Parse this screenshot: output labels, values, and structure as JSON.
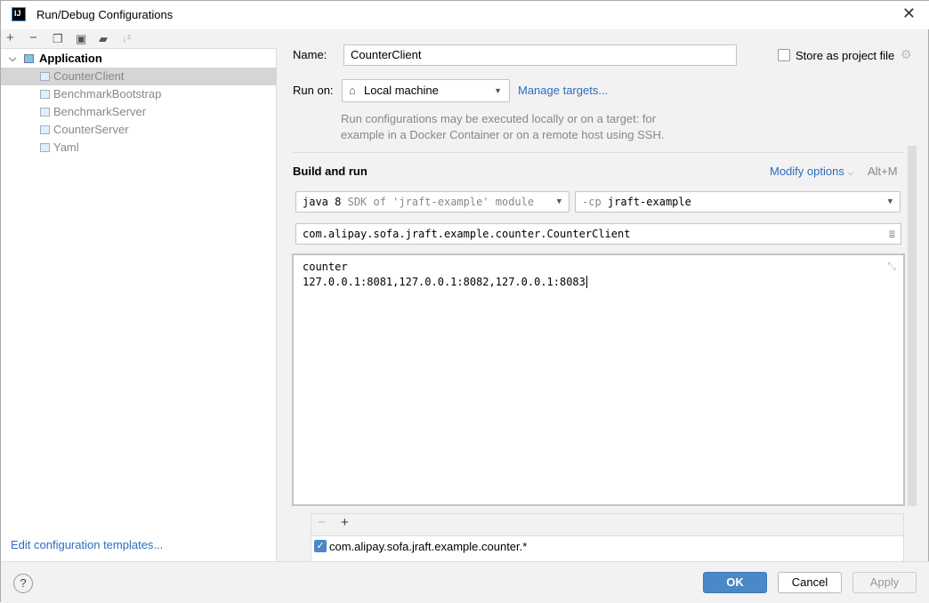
{
  "window": {
    "title": "Run/Debug Configurations",
    "app_icon": "IJ"
  },
  "toolbar": {
    "icons": [
      "plus-icon",
      "minus-icon",
      "copy-icon",
      "save-icon",
      "new-folder-icon",
      "sort-icon"
    ]
  },
  "tree": {
    "group": "Application",
    "items": [
      "CounterClient",
      "BenchmarkBootstrap",
      "BenchmarkServer",
      "CounterServer",
      "Yaml"
    ],
    "selected": "CounterClient"
  },
  "edit_templates": "Edit configuration templates...",
  "form": {
    "name_label": "Name:",
    "name_value": "CounterClient",
    "store_label": "Store as project file",
    "store_checked": false,
    "run_on_label": "Run on:",
    "run_on_value": "Local machine",
    "manage_targets": "Manage targets...",
    "hint_line1": "Run configurations may be executed locally or on a target: for",
    "hint_line2": "example in a Docker Container or on a remote host using SSH.",
    "section": "Build and run",
    "modify_options": "Modify options",
    "modify_shortcut": "Alt+M",
    "jre_main": "java 8",
    "jre_hint": "SDK of 'jraft-example' module",
    "cp_prefix": "-cp",
    "cp_value": "jraft-example",
    "main_class": "com.alipay.sofa.jraft.example.counter.CounterClient",
    "args_line1": "counter",
    "args_line2": "127.0.0.1:8081,127.0.0.1:8082,127.0.0.1:8083",
    "coverage_pattern": "com.alipay.sofa.jraft.example.counter.*",
    "coverage_checked": true
  },
  "buttons": {
    "ok": "OK",
    "cancel": "Cancel",
    "apply": "Apply",
    "help": "?"
  },
  "colors": {
    "accent": "#4a88c7",
    "link": "#2d6cbf",
    "selection": "#d5d5d5"
  }
}
